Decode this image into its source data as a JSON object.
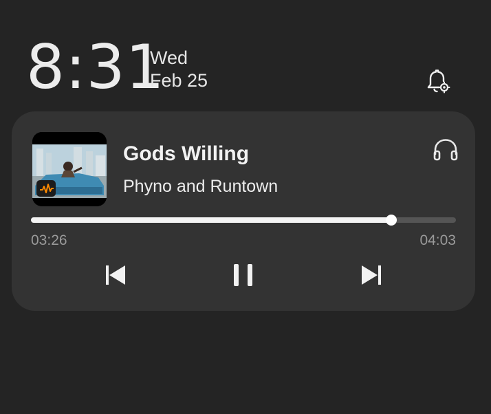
{
  "clock": {
    "time": "8:31",
    "day": "Wed",
    "date": "Feb 25"
  },
  "media": {
    "title": "Gods Willing",
    "artist": "Phyno and Runtown",
    "elapsed": "03:26",
    "total": "04:03",
    "progress": 0.848,
    "app_badge_icon": "audiomack-icon",
    "output_icon": "headphones-icon",
    "controls": [
      "previous-icon",
      "pause-icon",
      "next-icon"
    ]
  },
  "header_icons": [
    "notification-settings-icon"
  ],
  "colors": {
    "background": "#242424",
    "card": "#333333",
    "progress_fill": "#f4f4f4",
    "progress_track": "#555555",
    "app_badge": "#ff8a00"
  }
}
